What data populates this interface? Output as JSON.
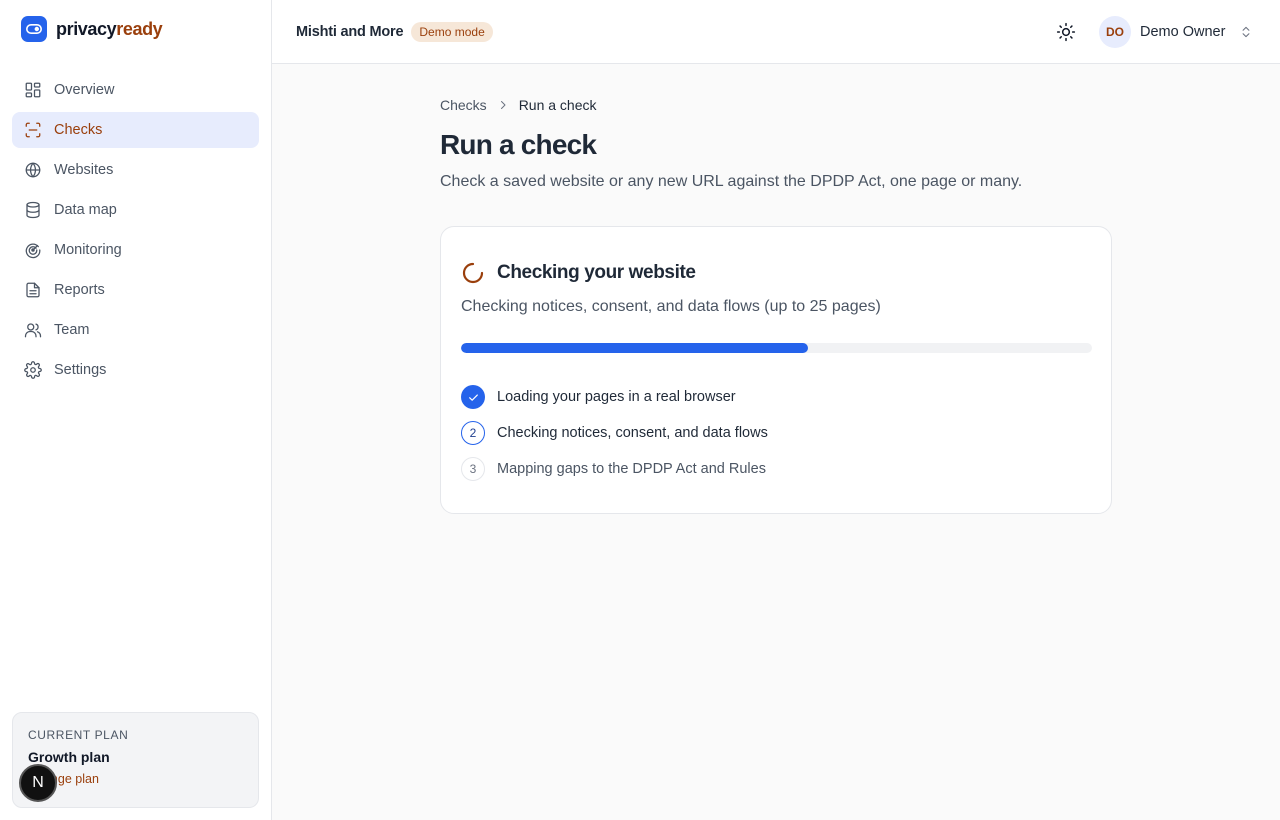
{
  "brand": {
    "name_part1": "privacy",
    "name_part2": "ready"
  },
  "sidebar": {
    "items": [
      {
        "label": "Overview",
        "icon": "grid-icon",
        "active": false
      },
      {
        "label": "Checks",
        "icon": "scan-icon",
        "active": true
      },
      {
        "label": "Websites",
        "icon": "globe-icon",
        "active": false
      },
      {
        "label": "Data map",
        "icon": "database-icon",
        "active": false
      },
      {
        "label": "Monitoring",
        "icon": "radar-icon",
        "active": false
      },
      {
        "label": "Reports",
        "icon": "document-icon",
        "active": false
      },
      {
        "label": "Team",
        "icon": "users-icon",
        "active": false
      },
      {
        "label": "Settings",
        "icon": "gear-icon",
        "active": false
      }
    ],
    "plan": {
      "kicker": "CURRENT PLAN",
      "name": "Growth plan",
      "link": "Change plan"
    },
    "n_badge": "N"
  },
  "topbar": {
    "org_name": "Mishti and More",
    "demo_badge": "Demo mode",
    "user_initials": "DO",
    "user_name": "Demo Owner"
  },
  "main": {
    "breadcrumb": {
      "parent": "Checks",
      "current": "Run a check"
    },
    "title": "Run a check",
    "subtitle": "Check a saved website or any new URL against the DPDP Act, one page or many.",
    "card": {
      "title": "Checking your website",
      "subtitle": "Checking notices, consent, and data flows (up to 25 pages)",
      "progress_percent": 55,
      "steps": [
        {
          "number": "1",
          "label": "Loading your pages in a real browser",
          "status": "done"
        },
        {
          "number": "2",
          "label": "Checking notices, consent, and data flows",
          "status": "current"
        },
        {
          "number": "3",
          "label": "Mapping gaps to the DPDP Act and Rules",
          "status": "pending"
        }
      ]
    }
  },
  "colors": {
    "accent": "#2563eb",
    "brand_secondary": "#9a3f0c",
    "active_nav_bg": "#e7ecfd"
  }
}
